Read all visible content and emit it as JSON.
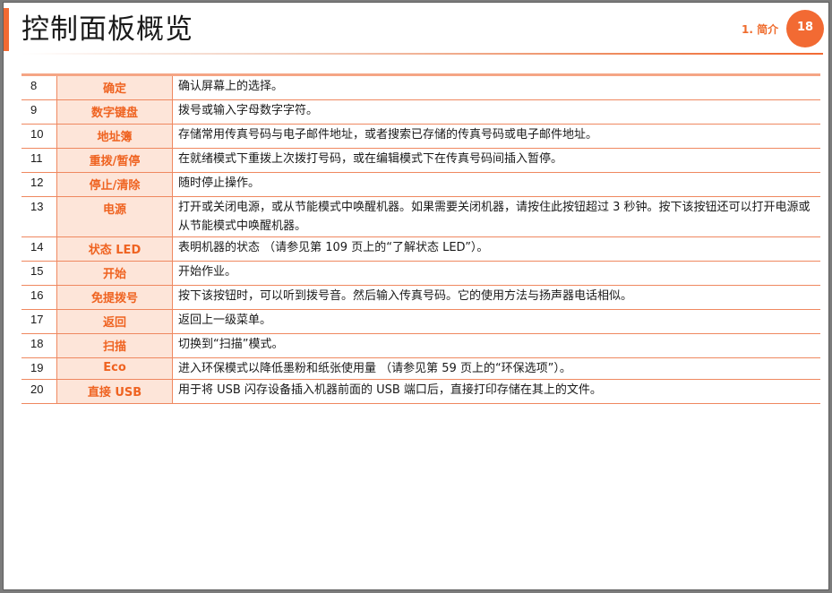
{
  "header": {
    "title": "控制面板概览",
    "chapter": "1. 简介",
    "page_number": "18"
  },
  "rows": [
    {
      "num": "8",
      "label": "确定",
      "desc": "确认屏幕上的选择。"
    },
    {
      "num": "9",
      "label": "数字键盘",
      "desc": "拨号或输入字母数字字符。"
    },
    {
      "num": "10",
      "label": "地址簿",
      "desc": "存储常用传真号码与电子邮件地址，或者搜索已存储的传真号码或电子邮件地址。"
    },
    {
      "num": "11",
      "label": "重拨/暂停",
      "desc": "在就绪模式下重拨上次拨打号码，或在编辑模式下在传真号码间插入暂停。"
    },
    {
      "num": "12",
      "label": "停止/清除",
      "desc": "随时停止操作。"
    },
    {
      "num": "13",
      "label": "电源",
      "desc": "打开或关闭电源，或从节能模式中唤醒机器。如果需要关闭机器，请按住此按钮超过 3 秒钟。按下该按钮还可以打开电源或从节能模式中唤醒机器。"
    },
    {
      "num": "14",
      "label": "状态 LED",
      "desc": "表明机器的状态 （请参见第 109 页上的“了解状态 LED”）。"
    },
    {
      "num": "15",
      "label": "开始",
      "desc": "开始作业。"
    },
    {
      "num": "16",
      "label": "免提拨号",
      "desc": "按下该按钮时，可以听到拨号音。然后输入传真号码。它的使用方法与扬声器电话相似。"
    },
    {
      "num": "17",
      "label": "返回",
      "desc": "返回上一级菜单。"
    },
    {
      "num": "18",
      "label": "扫描",
      "desc": "切换到“扫描”模式。"
    },
    {
      "num": "19",
      "label": "Eco",
      "desc": "进入环保模式以降低墨粉和纸张使用量 （请参见第 59 页上的“环保选项”）。"
    },
    {
      "num": "20",
      "label": "直接 USB",
      "desc": "用于将 USB 闪存设备插入机器前面的 USB 端口后，直接打印存储在其上的文件。"
    }
  ],
  "colors": {
    "accent": "#f26a33",
    "label_background": "#fde5d9",
    "label_text": "#ef6321",
    "rule": "#ef8860"
  }
}
